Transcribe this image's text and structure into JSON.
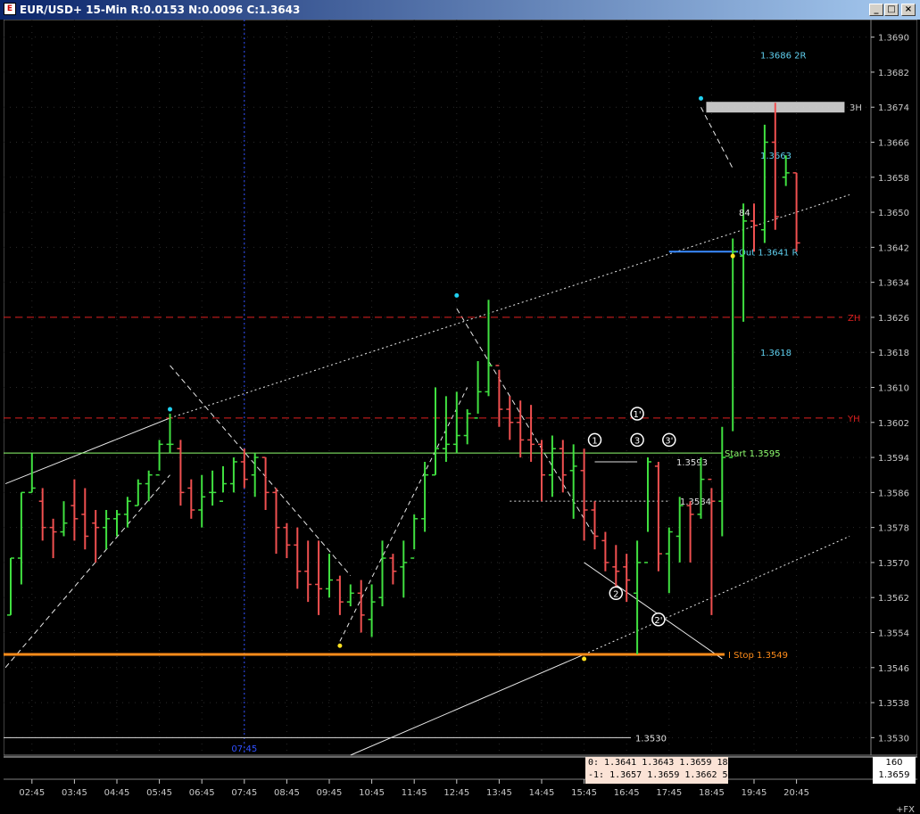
{
  "window": {
    "title": "EUR/USD+ 15-Min R:0.0153 N:0.0096 C:1.3643",
    "buttons": {
      "minimize": "_",
      "maximize": "□",
      "close": "×"
    }
  },
  "chart_data": {
    "type": "bar",
    "subtype": "ohlc",
    "instrument": "EUR/USD+",
    "interval": "15-Min",
    "ylim": [
      1.3526,
      1.3694
    ],
    "y_ticks": [
      "1.3690",
      "1.3682",
      "1.3674",
      "1.3666",
      "1.3658",
      "1.3650",
      "1.3642",
      "1.3634",
      "1.3626",
      "1.3618",
      "1.3610",
      "1.3602",
      "1.3594",
      "1.3586",
      "1.3578",
      "1.3570",
      "1.3562",
      "1.3554",
      "1.3546",
      "1.3538",
      "1.3530"
    ],
    "x_ticks": [
      "02:45",
      "03:45",
      "04:45",
      "05:45",
      "06:45",
      "07:45",
      "08:45",
      "09:45",
      "10:45",
      "11:45",
      "12:45",
      "13:45",
      "14:45",
      "15:45",
      "16:45",
      "17:45",
      "18:45",
      "19:45",
      "20:45"
    ],
    "x_tick_start_bar": 2,
    "bars_per_tick": 4,
    "grid": true,
    "bar_colors": {
      "up": "#40e040",
      "down": "#f05050"
    },
    "bars": [
      {
        "o": 1.3558,
        "h": 1.3571,
        "l": 1.3558,
        "c": 1.3571
      },
      {
        "o": 1.3571,
        "h": 1.3586,
        "l": 1.3565,
        "c": 1.3586
      },
      {
        "o": 1.3586,
        "h": 1.3595,
        "l": 1.3586,
        "c": 1.3587
      },
      {
        "o": 1.3584,
        "h": 1.3587,
        "l": 1.3575,
        "c": 1.3578
      },
      {
        "o": 1.3578,
        "h": 1.358,
        "l": 1.3571,
        "c": 1.3577
      },
      {
        "o": 1.3577,
        "h": 1.3584,
        "l": 1.3576,
        "c": 1.3579
      },
      {
        "o": 1.3583,
        "h": 1.3589,
        "l": 1.3575,
        "c": 1.358
      },
      {
        "o": 1.3581,
        "h": 1.3587,
        "l": 1.3573,
        "c": 1.3576
      },
      {
        "o": 1.3579,
        "h": 1.3582,
        "l": 1.357,
        "c": 1.3578
      },
      {
        "o": 1.3578,
        "h": 1.3582,
        "l": 1.3573,
        "c": 1.358
      },
      {
        "o": 1.358,
        "h": 1.3582,
        "l": 1.3576,
        "c": 1.3581
      },
      {
        "o": 1.3581,
        "h": 1.3585,
        "l": 1.3578,
        "c": 1.3584
      },
      {
        "o": 1.3583,
        "h": 1.3589,
        "l": 1.3583,
        "c": 1.3588
      },
      {
        "o": 1.3588,
        "h": 1.3591,
        "l": 1.3584,
        "c": 1.359
      },
      {
        "o": 1.359,
        "h": 1.3598,
        "l": 1.3591,
        "c": 1.3597
      },
      {
        "o": 1.3597,
        "h": 1.3604,
        "l": 1.3595,
        "c": 1.3597
      },
      {
        "o": 1.3596,
        "h": 1.3598,
        "l": 1.3583,
        "c": 1.3586
      },
      {
        "o": 1.3587,
        "h": 1.3589,
        "l": 1.358,
        "c": 1.3582
      },
      {
        "o": 1.3582,
        "h": 1.359,
        "l": 1.3578,
        "c": 1.3585
      },
      {
        "o": 1.3586,
        "h": 1.3591,
        "l": 1.3583,
        "c": 1.3586
      },
      {
        "o": 1.3584,
        "h": 1.3592,
        "l": 1.3586,
        "c": 1.3588
      },
      {
        "o": 1.3588,
        "h": 1.3594,
        "l": 1.3586,
        "c": 1.3593
      },
      {
        "o": 1.3593,
        "h": 1.3596,
        "l": 1.3587,
        "c": 1.3589
      },
      {
        "o": 1.359,
        "h": 1.3595,
        "l": 1.3585,
        "c": 1.3594
      },
      {
        "o": 1.3594,
        "h": 1.3594,
        "l": 1.3582,
        "c": 1.3586
      },
      {
        "o": 1.3586,
        "h": 1.3587,
        "l": 1.3572,
        "c": 1.3578
      },
      {
        "o": 1.3578,
        "h": 1.3579,
        "l": 1.3571,
        "c": 1.3574
      },
      {
        "o": 1.3574,
        "h": 1.3578,
        "l": 1.3564,
        "c": 1.3568
      },
      {
        "o": 1.3568,
        "h": 1.3575,
        "l": 1.3561,
        "c": 1.3565
      },
      {
        "o": 1.3565,
        "h": 1.3575,
        "l": 1.3558,
        "c": 1.3564
      },
      {
        "o": 1.3564,
        "h": 1.3572,
        "l": 1.3562,
        "c": 1.3566
      },
      {
        "o": 1.3566,
        "h": 1.3567,
        "l": 1.3558,
        "c": 1.3561
      },
      {
        "o": 1.3561,
        "h": 1.3565,
        "l": 1.356,
        "c": 1.3563
      },
      {
        "o": 1.3563,
        "h": 1.3566,
        "l": 1.3554,
        "c": 1.3558
      },
      {
        "o": 1.3557,
        "h": 1.3565,
        "l": 1.3553,
        "c": 1.3561
      },
      {
        "o": 1.3562,
        "h": 1.3575,
        "l": 1.356,
        "c": 1.3571
      },
      {
        "o": 1.3571,
        "h": 1.3572,
        "l": 1.3565,
        "c": 1.3568
      },
      {
        "o": 1.3569,
        "h": 1.3575,
        "l": 1.3562,
        "c": 1.357
      },
      {
        "o": 1.3571,
        "h": 1.3581,
        "l": 1.3573,
        "c": 1.358
      },
      {
        "o": 1.358,
        "h": 1.3593,
        "l": 1.3577,
        "c": 1.359
      },
      {
        "o": 1.359,
        "h": 1.361,
        "l": 1.359,
        "c": 1.3596
      },
      {
        "o": 1.3596,
        "h": 1.3608,
        "l": 1.3593,
        "c": 1.3597
      },
      {
        "o": 1.3597,
        "h": 1.3609,
        "l": 1.3595,
        "c": 1.3599
      },
      {
        "o": 1.3599,
        "h": 1.3605,
        "l": 1.3597,
        "c": 1.3604
      },
      {
        "o": 1.3603,
        "h": 1.3616,
        "l": 1.3604,
        "c": 1.3609
      },
      {
        "o": 1.3609,
        "h": 1.363,
        "l": 1.3608,
        "c": 1.3615
      },
      {
        "o": 1.3615,
        "h": 1.3614,
        "l": 1.3601,
        "c": 1.3605
      },
      {
        "o": 1.3605,
        "h": 1.3608,
        "l": 1.3598,
        "c": 1.3602
      },
      {
        "o": 1.3602,
        "h": 1.3607,
        "l": 1.3594,
        "c": 1.3598
      },
      {
        "o": 1.3598,
        "h": 1.3606,
        "l": 1.3593,
        "c": 1.3597
      },
      {
        "o": 1.3597,
        "h": 1.3598,
        "l": 1.3584,
        "c": 1.359
      },
      {
        "o": 1.359,
        "h": 1.3599,
        "l": 1.3585,
        "c": 1.3596
      },
      {
        "o": 1.3596,
        "h": 1.3598,
        "l": 1.3586,
        "c": 1.359
      },
      {
        "o": 1.3591,
        "h": 1.3597,
        "l": 1.358,
        "c": 1.3592
      },
      {
        "o": 1.3591,
        "h": 1.3596,
        "l": 1.3575,
        "c": 1.3582
      },
      {
        "o": 1.3582,
        "h": 1.3584,
        "l": 1.3573,
        "c": 1.3576
      },
      {
        "o": 1.3575,
        "h": 1.3577,
        "l": 1.3568,
        "c": 1.357
      },
      {
        "o": 1.3569,
        "h": 1.3574,
        "l": 1.3564,
        "c": 1.3568
      },
      {
        "o": 1.3569,
        "h": 1.3572,
        "l": 1.3561,
        "c": 1.3566
      },
      {
        "o": 1.3563,
        "h": 1.3575,
        "l": 1.3549,
        "c": 1.357
      },
      {
        "o": 1.357,
        "h": 1.3594,
        "l": 1.3577,
        "c": 1.3593
      },
      {
        "o": 1.3592,
        "h": 1.3593,
        "l": 1.3568,
        "c": 1.3572
      },
      {
        "o": 1.3572,
        "h": 1.3578,
        "l": 1.3563,
        "c": 1.3577
      },
      {
        "o": 1.3576,
        "h": 1.3585,
        "l": 1.357,
        "c": 1.3583
      },
      {
        "o": 1.3583,
        "h": 1.3584,
        "l": 1.357,
        "c": 1.3581
      },
      {
        "o": 1.3581,
        "h": 1.3594,
        "l": 1.358,
        "c": 1.3589
      },
      {
        "o": 1.3589,
        "h": 1.3587,
        "l": 1.3558,
        "c": 1.3584
      },
      {
        "o": 1.3584,
        "h": 1.3601,
        "l": 1.3576,
        "c": 1.3594
      },
      {
        "o": 1.3594,
        "h": 1.3644,
        "l": 1.36,
        "c": 1.3641
      },
      {
        "o": 1.364,
        "h": 1.3652,
        "l": 1.3625,
        "c": 1.3648
      },
      {
        "o": 1.3648,
        "h": 1.3652,
        "l": 1.3641,
        "c": 1.3647
      },
      {
        "o": 1.3646,
        "h": 1.367,
        "l": 1.3643,
        "c": 1.3666
      },
      {
        "o": 1.3666,
        "h": 1.3675,
        "l": 1.3646,
        "c": 1.3649
      },
      {
        "o": 1.3658,
        "h": 1.3663,
        "l": 1.3656,
        "c": 1.3659
      },
      {
        "o": 1.3659,
        "h": 1.3659,
        "l": 1.3641,
        "c": 1.3643
      }
    ],
    "horizontal_levels": [
      {
        "label": "1.3686 2R",
        "price": 1.3686,
        "color": "#5fd0f0",
        "line": false
      },
      {
        "label": "3H",
        "price": 1.3674,
        "color": "#c8c8c8",
        "line": false
      },
      {
        "label": "1.3663",
        "price": 1.3663,
        "color": "#5fd0f0",
        "line": false
      },
      {
        "label": "Out 1.3641 R",
        "price": 1.3641,
        "color": "#5fd0f0",
        "line": true
      },
      {
        "label": "ZH",
        "price": 1.3626,
        "color": "#e02020",
        "line": true,
        "dashed": true
      },
      {
        "label": "1.3618",
        "price": 1.3618,
        "color": "#5fd0f0",
        "line": false
      },
      {
        "label": "YH",
        "price": 1.3603,
        "color": "#e02020",
        "line": true,
        "dashed": true
      },
      {
        "label": "Start 1.3595",
        "price": 1.3595,
        "color": "#90ff70",
        "line": true
      },
      {
        "label": "1.3593",
        "price": 1.3593,
        "color": "#e0e0e0",
        "line": true
      },
      {
        "label": "1.3584",
        "price": 1.3584,
        "color": "#e0e0e0",
        "line": true,
        "dashed": true
      },
      {
        "label": "I Stop 1.3549",
        "price": 1.3549,
        "color": "#ff8c1a",
        "line": true
      },
      {
        "label": "1.3530",
        "price": 1.353,
        "color": "#e0e0e0",
        "line": true
      }
    ],
    "annotations": [
      "1",
      "1'",
      "2",
      "2'",
      "3",
      "3'",
      "84"
    ],
    "cursor_time_label": "07:45",
    "info_panel": {
      "row0": "0: 1.3641  1.3643  1.3659  18",
      "row1": "-1: 1.3657  1.3659  1.3662  5"
    },
    "corner_panel": {
      "top": "160",
      "bottom": "1.3659"
    },
    "footer_label": "+FX"
  }
}
